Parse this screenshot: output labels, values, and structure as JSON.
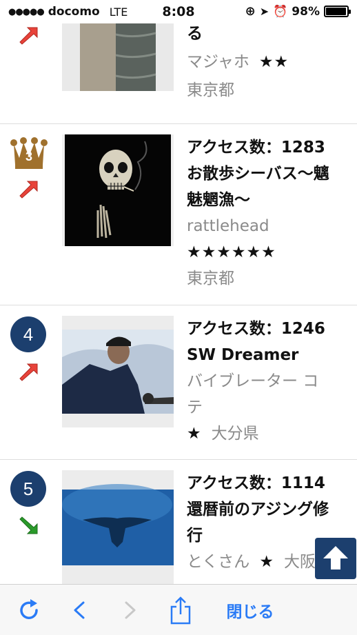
{
  "status_bar": {
    "signal": "●●●●●",
    "carrier": "docomo",
    "network": "LTE",
    "time": "8:08",
    "battery": "98%",
    "battery_level": 0.98
  },
  "rows": [
    {
      "title": "ヒラメの人は惑考する",
      "title_visible": "る",
      "user": "マジャホ",
      "stars": "★★",
      "prefecture": "東京都",
      "trend": "up"
    },
    {
      "rank": "3",
      "title": "アクセス数：1283",
      "subtitle_line1": "お散歩シーバス〜魑",
      "subtitle_line2": "魅魍漁〜",
      "user": "rattlehead",
      "stars": "★★★★★★",
      "prefecture": "東京都",
      "trend": "up"
    },
    {
      "rank": "4",
      "title": "アクセス数：1246",
      "subtitle_line1": "SW Dreamer",
      "user_line1": "バイブレーター コ",
      "user_line2": "テ",
      "stars": "★",
      "prefecture": "大分県",
      "trend": "up"
    },
    {
      "rank": "5",
      "title": "アクセス数：1114",
      "subtitle_line1": "還暦前のアジング修",
      "subtitle_line2": "行",
      "user": "とくさん",
      "stars": "★",
      "prefecture": "大阪府",
      "trend": "down"
    }
  ],
  "toolbar": {
    "close_label": "閉じる"
  },
  "colors": {
    "accent": "#2a7bf6",
    "badge": "#1c3f6e",
    "trend_up": "#e8433a",
    "trend_down": "#2a9a2a"
  }
}
